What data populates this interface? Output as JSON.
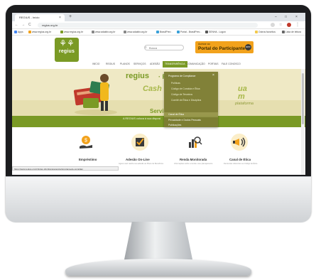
{
  "browser": {
    "tab_title": "REGIUS - Início",
    "tab_close": "×",
    "new_tab": "+",
    "url": "regius.org.br",
    "window_controls": [
      "–",
      "□",
      "×"
    ],
    "nav": {
      "back": "←",
      "forward": "→",
      "reload": "C"
    },
    "bookmarks": [
      {
        "label": "Apps",
        "color": "#4285f4"
      },
      {
        "label": "www.regius.org.br",
        "color": "#f2a21c"
      },
      {
        "label": "www.regius.org.br",
        "color": "#7a9a25"
      },
      {
        "label": "www.adaktiv.org.br",
        "color": "#888888"
      },
      {
        "label": "www.adaktiv.org.br",
        "color": "#888888"
      },
      {
        "label": "BrasilPrev -",
        "color": "#3aa0d8"
      },
      {
        "label": "Portal - BrasilPrev -",
        "color": "#3aa0d8"
      },
      {
        "label": "SENHA - Logon",
        "color": "#555555"
      },
      {
        "label": "Outros favoritos",
        "color": "#f2c94c"
      },
      {
        "label": "Lista de leitura",
        "color": "#666666"
      }
    ],
    "status_bar": "https://www.regius.org.br/index.php/transparencia/programa-de-complian"
  },
  "site": {
    "logo_text": "regius",
    "search_placeholder": "Busca",
    "portal": {
      "small": "Acesse ao",
      "big": "Portal do Participante",
      "badge": "IRPF"
    },
    "nav": [
      {
        "label": "INÍCIO",
        "active": false
      },
      {
        "label": "REGIUS",
        "active": false
      },
      {
        "label": "PLANOS",
        "active": false
      },
      {
        "label": "SERVIÇOS",
        "active": false
      },
      {
        "label": "ADESÃO",
        "active": false
      },
      {
        "label": "TRANSPARÊNCIA",
        "active": true
      },
      {
        "label": "COMUNICAÇÃO",
        "active": false
      },
      {
        "label": "PORTAIS",
        "active": false
      },
      {
        "label": "FALE CONOSCO",
        "active": false
      }
    ]
  },
  "hero": {
    "logo": "regius",
    "logo_tail": "· PR",
    "text1": "Cash",
    "text2": "ua",
    "text3": "m",
    "text4": "plataforma",
    "band_title": "Servi",
    "band_sub": "A REGIUS coloca à sua disposi"
  },
  "dropdown": {
    "close": "×",
    "items": [
      {
        "label": "Programa de Compliance",
        "sub": false
      },
      {
        "label": "Políticas",
        "sub": true
      },
      {
        "label": "Código de Conduta e Ética",
        "sub": true
      },
      {
        "label": "Código de Terceiros",
        "sub": true
      },
      {
        "label": "Comitê de Ética e Disciplina",
        "sub": true
      },
      {
        "label": "Canal de Ética",
        "sub": false
      },
      {
        "label": "Privacidade e Dados Pessoais",
        "sub": false
      },
      {
        "label": "Publicações",
        "sub": false
      }
    ]
  },
  "services": [
    {
      "title": "Empréstimo",
      "desc": "",
      "icon": "money-icon",
      "bg": "#ffffff"
    },
    {
      "title": "Adesão On-Line",
      "desc": "Agora você realiza sua adesão ao Plano de Benefícios",
      "icon": "checkbox-icon",
      "bg": "#fbeec9"
    },
    {
      "title": "Renda Monitorada",
      "desc": "Informações sobre a renda e seu planejamento",
      "icon": "chart-search-icon",
      "bg": "#ffffff"
    },
    {
      "title": "Canal de Ética",
      "desc": "Denúncias referentes ao Código de Ética",
      "icon": "megaphone-icon",
      "bg": "#fbeec9"
    }
  ]
}
